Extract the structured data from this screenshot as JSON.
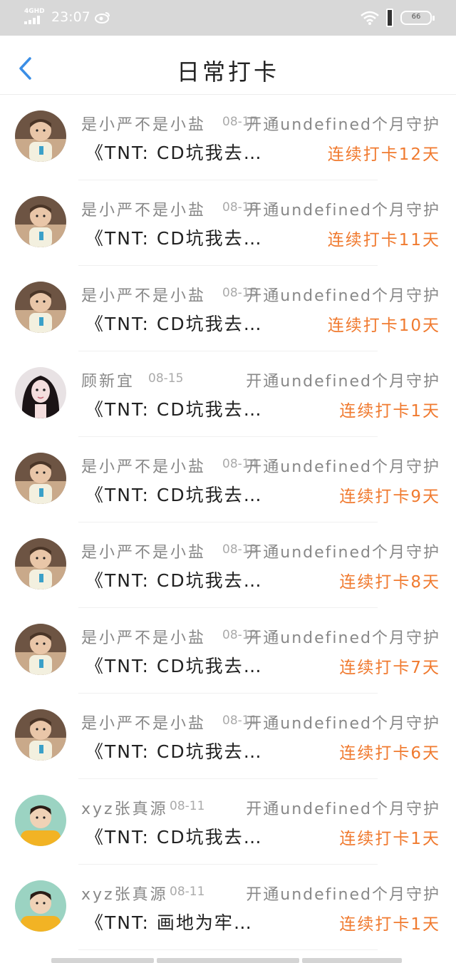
{
  "status_bar": {
    "network": "4GHD",
    "time": "23:07",
    "battery_level": "66",
    "icons": [
      "signal-icon",
      "weibo-icon",
      "wifi-icon",
      "sim-icon",
      "battery-icon"
    ]
  },
  "nav": {
    "title": "日常打卡",
    "back_icon": "chevron-left-icon",
    "accent_color": "#3a8ee6"
  },
  "colors": {
    "streak": "#f07a2f",
    "name": "#888888",
    "song": "#222222"
  },
  "rows": [
    {
      "name": "是小严不是小盐",
      "date": "08-17",
      "guard": "开通undefined个月守护",
      "song": "《TNT: CD坑我去…",
      "streak": "连续打卡12天",
      "avatar": "child"
    },
    {
      "name": "是小严不是小盐",
      "date": "08-16",
      "guard": "开通undefined个月守护",
      "song": "《TNT: CD坑我去…",
      "streak": "连续打卡11天",
      "avatar": "child"
    },
    {
      "name": "是小严不是小盐",
      "date": "08-15",
      "guard": "开通undefined个月守护",
      "song": "《TNT: CD坑我去…",
      "streak": "连续打卡10天",
      "avatar": "child"
    },
    {
      "name": "顾新宜",
      "date": "08-15",
      "guard": "开通undefined个月守护",
      "song": "《TNT: CD坑我去…",
      "streak": "连续打卡1天",
      "avatar": "girl"
    },
    {
      "name": "是小严不是小盐",
      "date": "08-14",
      "guard": "开通undefined个月守护",
      "song": "《TNT: CD坑我去…",
      "streak": "连续打卡9天",
      "avatar": "child"
    },
    {
      "name": "是小严不是小盐",
      "date": "08-13",
      "guard": "开通undefined个月守护",
      "song": "《TNT: CD坑我去…",
      "streak": "连续打卡8天",
      "avatar": "child"
    },
    {
      "name": "是小严不是小盐",
      "date": "08-12",
      "guard": "开通undefined个月守护",
      "song": "《TNT: CD坑我去…",
      "streak": "连续打卡7天",
      "avatar": "child"
    },
    {
      "name": "是小严不是小盐",
      "date": "08-11",
      "guard": "开通undefined个月守护",
      "song": "《TNT: CD坑我去…",
      "streak": "连续打卡6天",
      "avatar": "child"
    },
    {
      "name": "xyz张真源",
      "date": "08-11",
      "guard": "开通undefined个月守护",
      "song": "《TNT: CD坑我去…",
      "streak": "连续打卡1天",
      "avatar": "boy"
    },
    {
      "name": "xyz张真源",
      "date": "08-11",
      "guard": "开通undefined个月守护",
      "song": "《TNT: 画地为牢…",
      "streak": "连续打卡1天",
      "avatar": "boy"
    }
  ]
}
